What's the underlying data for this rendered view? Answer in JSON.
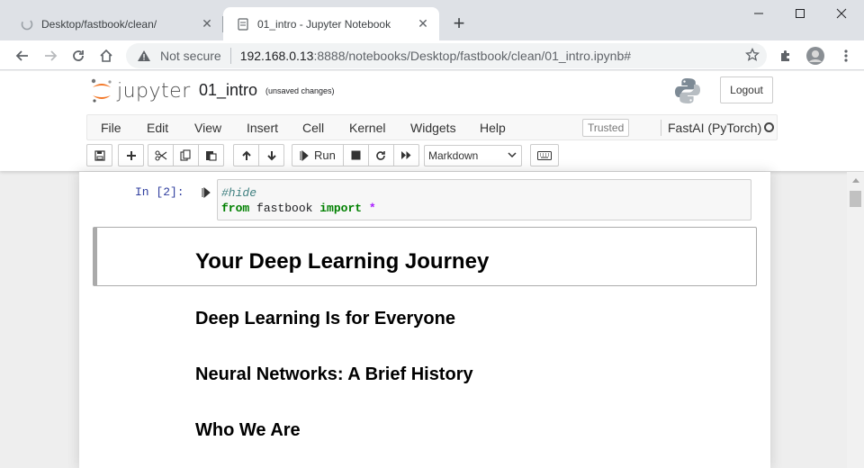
{
  "browser": {
    "tabs": [
      {
        "title": "Desktop/fastbook/clean/",
        "active": false
      },
      {
        "title": "01_intro - Jupyter Notebook",
        "active": true
      }
    ],
    "address": {
      "security_label": "Not secure",
      "host": "192.168.0.13",
      "rest": ":8888/notebooks/Desktop/fastbook/clean/01_intro.ipynb#"
    }
  },
  "jupyter": {
    "logo_text": "jupyter",
    "notebook_name": "01_intro",
    "save_status": "(unsaved changes)",
    "logout_label": "Logout",
    "menu": [
      "File",
      "Edit",
      "View",
      "Insert",
      "Cell",
      "Kernel",
      "Widgets",
      "Help"
    ],
    "trusted_label": "Trusted",
    "kernel_name": "FastAI (PyTorch)",
    "run_label": "Run",
    "cell_type": "Markdown"
  },
  "notebook": {
    "code_cell": {
      "prompt": "In [2]:",
      "line1": "#hide",
      "line2_kw1": "from",
      "line2_mod": " fastbook ",
      "line2_kw2": "import",
      "line2_star": " *"
    },
    "headings": {
      "h1": "Your Deep Learning Journey",
      "h2_items": [
        "Deep Learning Is for Everyone",
        "Neural Networks: A Brief History",
        "Who We Are"
      ]
    }
  },
  "colors": {
    "prompt_blue": "#303f9f",
    "comment": "#408080",
    "keyword": "#008000",
    "jupyter_orange": "#f37726"
  }
}
